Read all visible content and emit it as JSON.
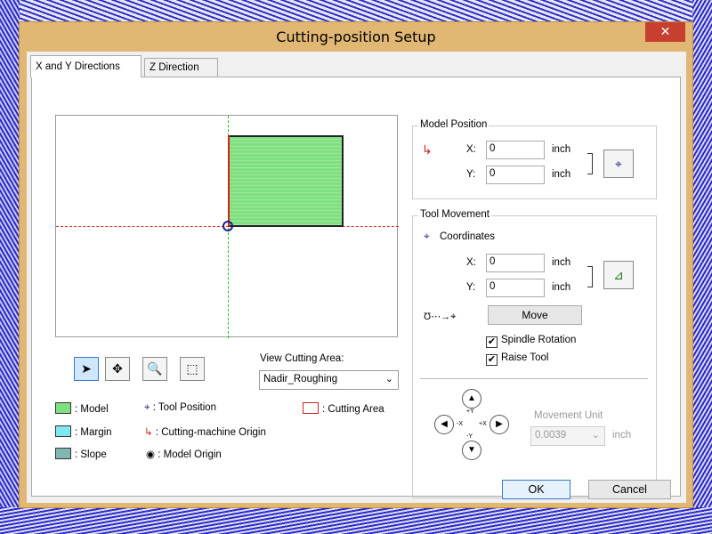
{
  "window": {
    "title": "Cutting-position Setup",
    "close_label": "✕"
  },
  "tabs": [
    {
      "label": "X and Y Directions",
      "active": true
    },
    {
      "label": "Z Direction",
      "active": false
    }
  ],
  "view": {
    "tools": [
      {
        "name": "select-tool",
        "icon": "cursor-arrow-icon",
        "glyph": "➤",
        "active": true
      },
      {
        "name": "pan-tool",
        "icon": "move-icon",
        "glyph": "✥",
        "active": false
      },
      {
        "name": "zoom-tool",
        "icon": "zoom-icon",
        "glyph": "🔍",
        "active": false
      },
      {
        "name": "fit-tool",
        "icon": "fit-view-icon",
        "glyph": "⬚",
        "active": false
      }
    ],
    "cutting_area_label": "View Cutting Area:",
    "cutting_area_value": "Nadir_Roughing"
  },
  "legend": {
    "model": ": Model",
    "margin": ": Margin",
    "slope": ": Slope",
    "tool_position": ": Tool Position",
    "machine_origin": ": Cutting-machine Origin",
    "model_origin": ": Model Origin",
    "cutting_area": ": Cutting Area",
    "colors": {
      "model": "#7fe07f",
      "margin": "#7fe8f0",
      "slope": "#7fb8b0",
      "cutting_area": "#d02020"
    }
  },
  "model_position": {
    "title": "Model Position",
    "x_label": "X:",
    "x_value": "0",
    "y_label": "Y:",
    "y_value": "0",
    "unit": "inch"
  },
  "tool_movement": {
    "title": "Tool Movement",
    "coordinates_label": "Coordinates",
    "x_label": "X:",
    "x_value": "0",
    "y_label": "Y:",
    "y_value": "0",
    "unit": "inch",
    "move_label": "Move",
    "spindle_rotation_label": "Spindle Rotation",
    "spindle_rotation_checked": true,
    "raise_tool_label": "Raise Tool",
    "raise_tool_checked": true
  },
  "movement": {
    "unit_label": "Movement Unit",
    "unit_value": "0.0039",
    "unit_suffix": "inch",
    "dpad": {
      "up": "+Y",
      "down": "-Y",
      "left": "-X",
      "right": "+X"
    }
  },
  "buttons": {
    "ok": "OK",
    "cancel": "Cancel"
  }
}
